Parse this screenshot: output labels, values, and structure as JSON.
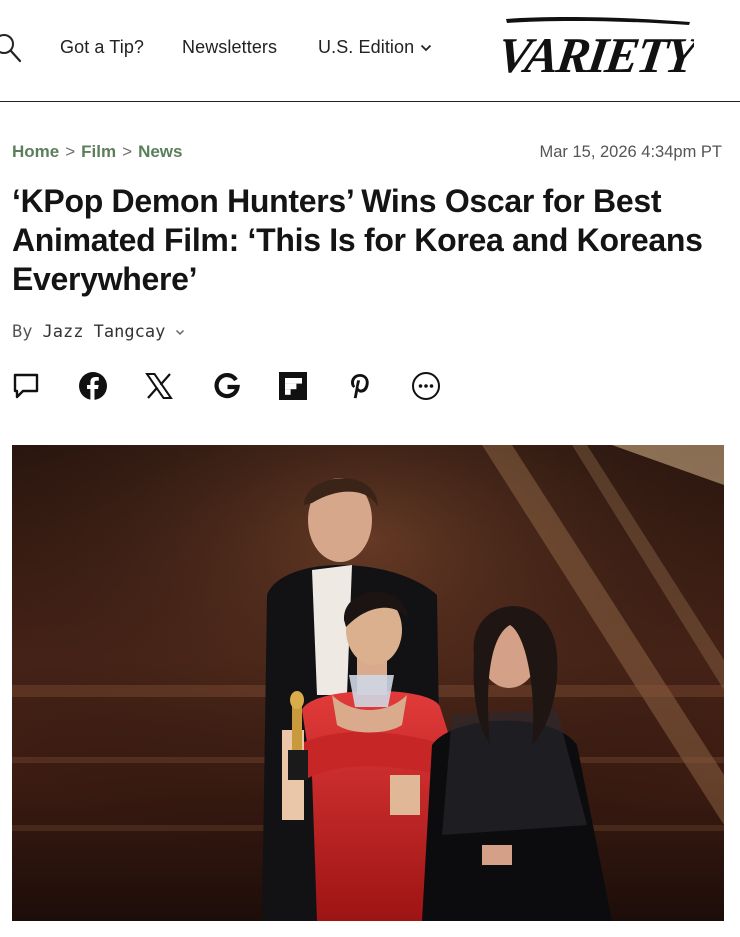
{
  "header": {
    "nav": {
      "tip": "Got a Tip?",
      "newsletters": "Newsletters",
      "edition": "U.S. Edition"
    },
    "logo_text": "VARIETY",
    "icons": [
      "search-icon",
      "chevron-down-icon"
    ]
  },
  "article": {
    "breadcrumb": {
      "home": "Home",
      "film": "Film",
      "news": "News",
      "separator": ">"
    },
    "timestamp": "Mar 15, 2026 4:34pm PT",
    "title": "‘KPop Demon Hunters’ Wins Oscar for Best Animated Film: ‘This Is for Korea and Koreans Everywhere’",
    "byline": {
      "prefix": "By",
      "author": "Jazz Tangcay"
    },
    "share_icons": [
      "comment-icon",
      "facebook-icon",
      "x-icon",
      "google-icon",
      "flipboard-icon",
      "pinterest-icon",
      "more-icon"
    ]
  },
  "colors": {
    "breadcrumb": "#5b7f5b",
    "text": "#141414",
    "muted": "#555555",
    "divider": "#222222"
  }
}
